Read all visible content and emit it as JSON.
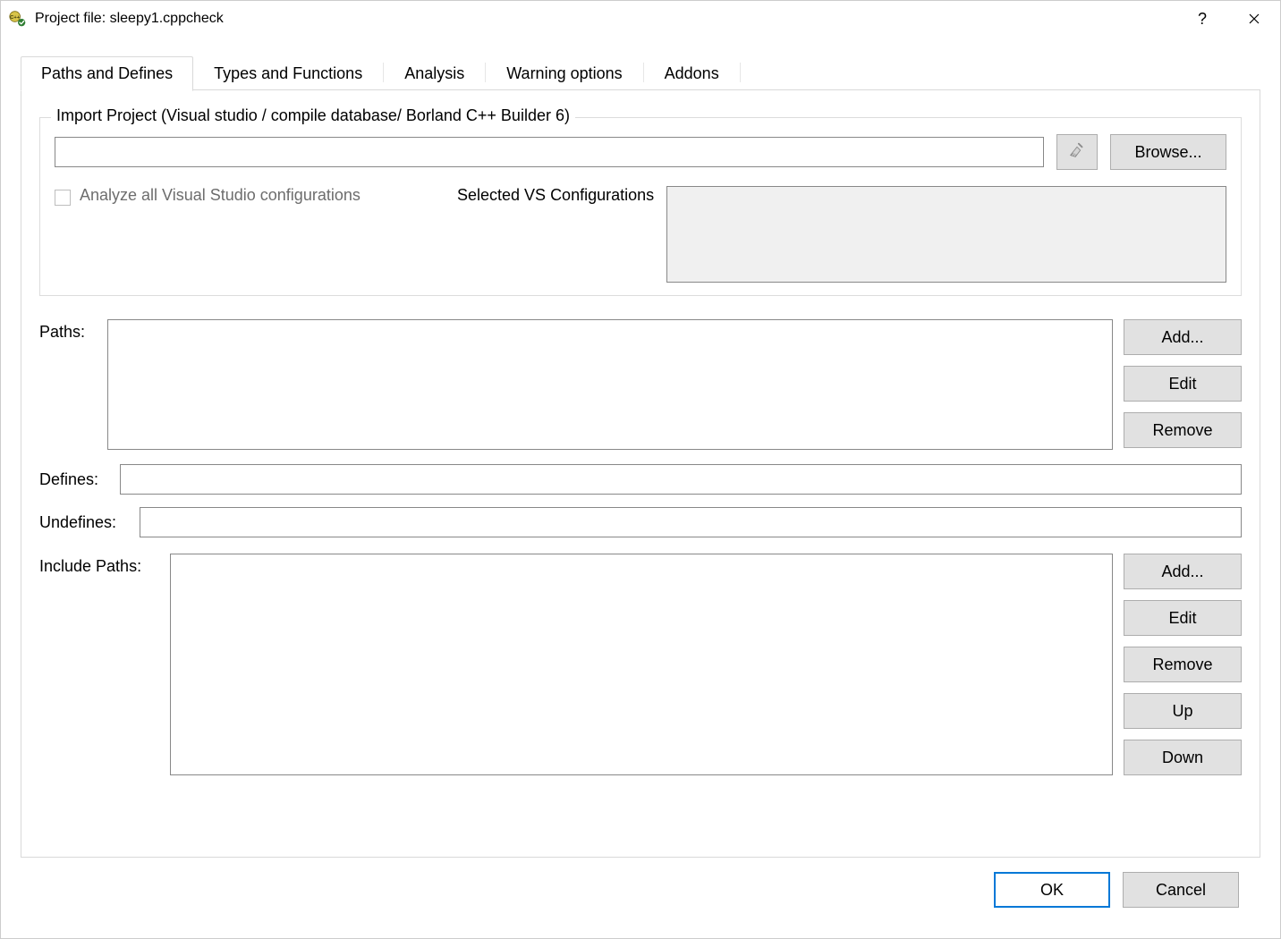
{
  "window": {
    "title": "Project file: sleepy1.cppcheck"
  },
  "tabs": {
    "paths_defines": "Paths and Defines",
    "types_functions": "Types and Functions",
    "analysis": "Analysis",
    "warning_options": "Warning options",
    "addons": "Addons"
  },
  "import_group": {
    "legend": "Import Project (Visual studio / compile database/ Borland C++ Builder 6)",
    "path_value": "",
    "browse_label": "Browse...",
    "analyze_all_label": "Analyze all Visual Studio configurations",
    "analyze_all_checked": false,
    "selected_vs_label": "Selected VS Configurations"
  },
  "paths_section": {
    "label": "Paths:",
    "add_label": "Add...",
    "edit_label": "Edit",
    "remove_label": "Remove",
    "items": []
  },
  "defines": {
    "label": "Defines:",
    "value": ""
  },
  "undefines": {
    "label": "Undefines:",
    "value": ""
  },
  "include_paths": {
    "label": "Include Paths:",
    "add_label": "Add...",
    "edit_label": "Edit",
    "remove_label": "Remove",
    "up_label": "Up",
    "down_label": "Down",
    "items": []
  },
  "dialog": {
    "ok": "OK",
    "cancel": "Cancel"
  }
}
